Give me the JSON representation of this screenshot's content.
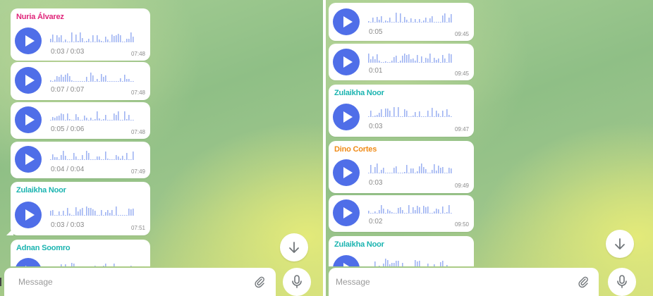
{
  "colors": {
    "accent": "#4f6ee8",
    "sender_pink": "#e0257a",
    "sender_teal": "#1bb4b0",
    "sender_orange": "#f08b18"
  },
  "left": {
    "messages": [
      {
        "sender": "Nuria Álvarez",
        "sender_color": "#e0257a",
        "duration": "0:03 / 0:03",
        "time": "07:48"
      },
      {
        "sender": "",
        "duration": "0:07 / 0:07",
        "time": "07:48"
      },
      {
        "sender": "",
        "duration": "0:05 / 0:06",
        "time": "07:48"
      },
      {
        "sender": "",
        "duration": "0:04 / 0:04",
        "time": "07:49"
      },
      {
        "sender": "Zulaikha Noor",
        "sender_color": "#1bb4b0",
        "duration": "0:03 / 0:03",
        "time": "07:51"
      },
      {
        "sender": "Adnan Soomro",
        "sender_color": "#1bb4b0",
        "duration": "",
        "time": ""
      }
    ],
    "composer": {
      "placeholder": "Message"
    }
  },
  "right": {
    "messages": [
      {
        "sender": "",
        "duration": "0:05",
        "time": "09:45"
      },
      {
        "sender": "",
        "duration": "0:01",
        "time": "09:45"
      },
      {
        "sender": "Zulaikha Noor",
        "sender_color": "#1bb4b0",
        "duration": "0:03",
        "time": "09:47"
      },
      {
        "sender": "Dino Cortes",
        "sender_color": "#f08b18",
        "duration": "0:03",
        "time": "09:49"
      },
      {
        "sender": "",
        "duration": "0:02",
        "time": "09:50"
      },
      {
        "sender": "Zulaikha Noor",
        "sender_color": "#1bb4b0",
        "duration": "",
        "time": ""
      }
    ],
    "composer": {
      "placeholder": "Message"
    }
  },
  "icons": {
    "play": "play-icon",
    "attach": "paperclip-icon",
    "mic": "microphone-icon",
    "scroll": "arrow-down-icon"
  }
}
